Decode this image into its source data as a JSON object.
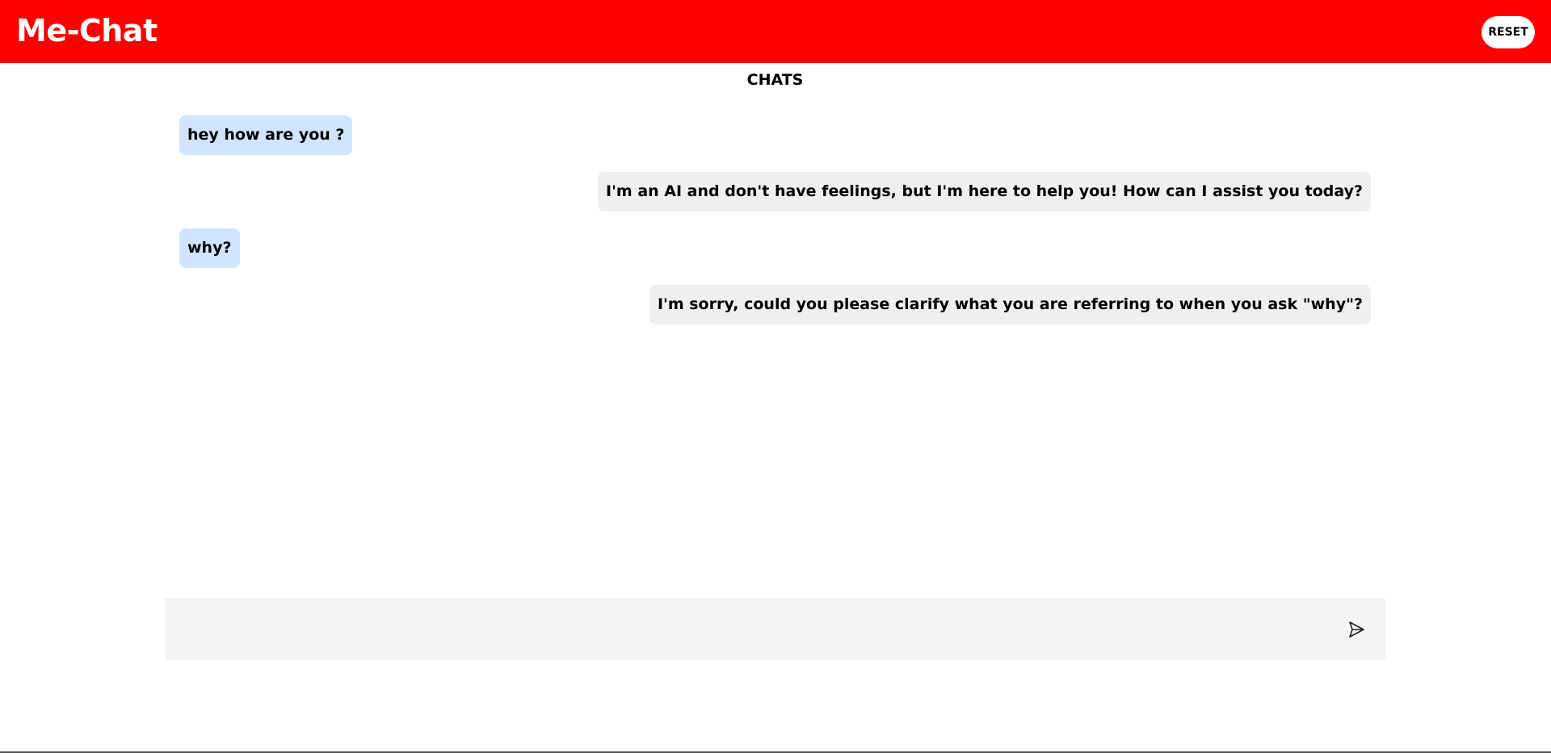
{
  "header": {
    "brand": "Me-Chat",
    "reset_label": "RESET",
    "background_color": "#ff0000"
  },
  "main": {
    "title": "CHATS"
  },
  "messages": [
    {
      "sender": "user",
      "text": "hey how are you ?"
    },
    {
      "sender": "bot",
      "text": "I'm an AI and don't have feelings, but I'm here to help you! How can I assist you today?"
    },
    {
      "sender": "user",
      "text": "why?"
    },
    {
      "sender": "bot",
      "text": "I'm sorry, could you please clarify what you are referring to when you ask \"why\"?"
    }
  ],
  "composer": {
    "input_value": "",
    "placeholder": "",
    "send_icon": "send-icon"
  },
  "colors": {
    "user_bubble": "#cfe5ff",
    "bot_bubble": "#efefef",
    "composer_bg": "#f4f4f4"
  }
}
